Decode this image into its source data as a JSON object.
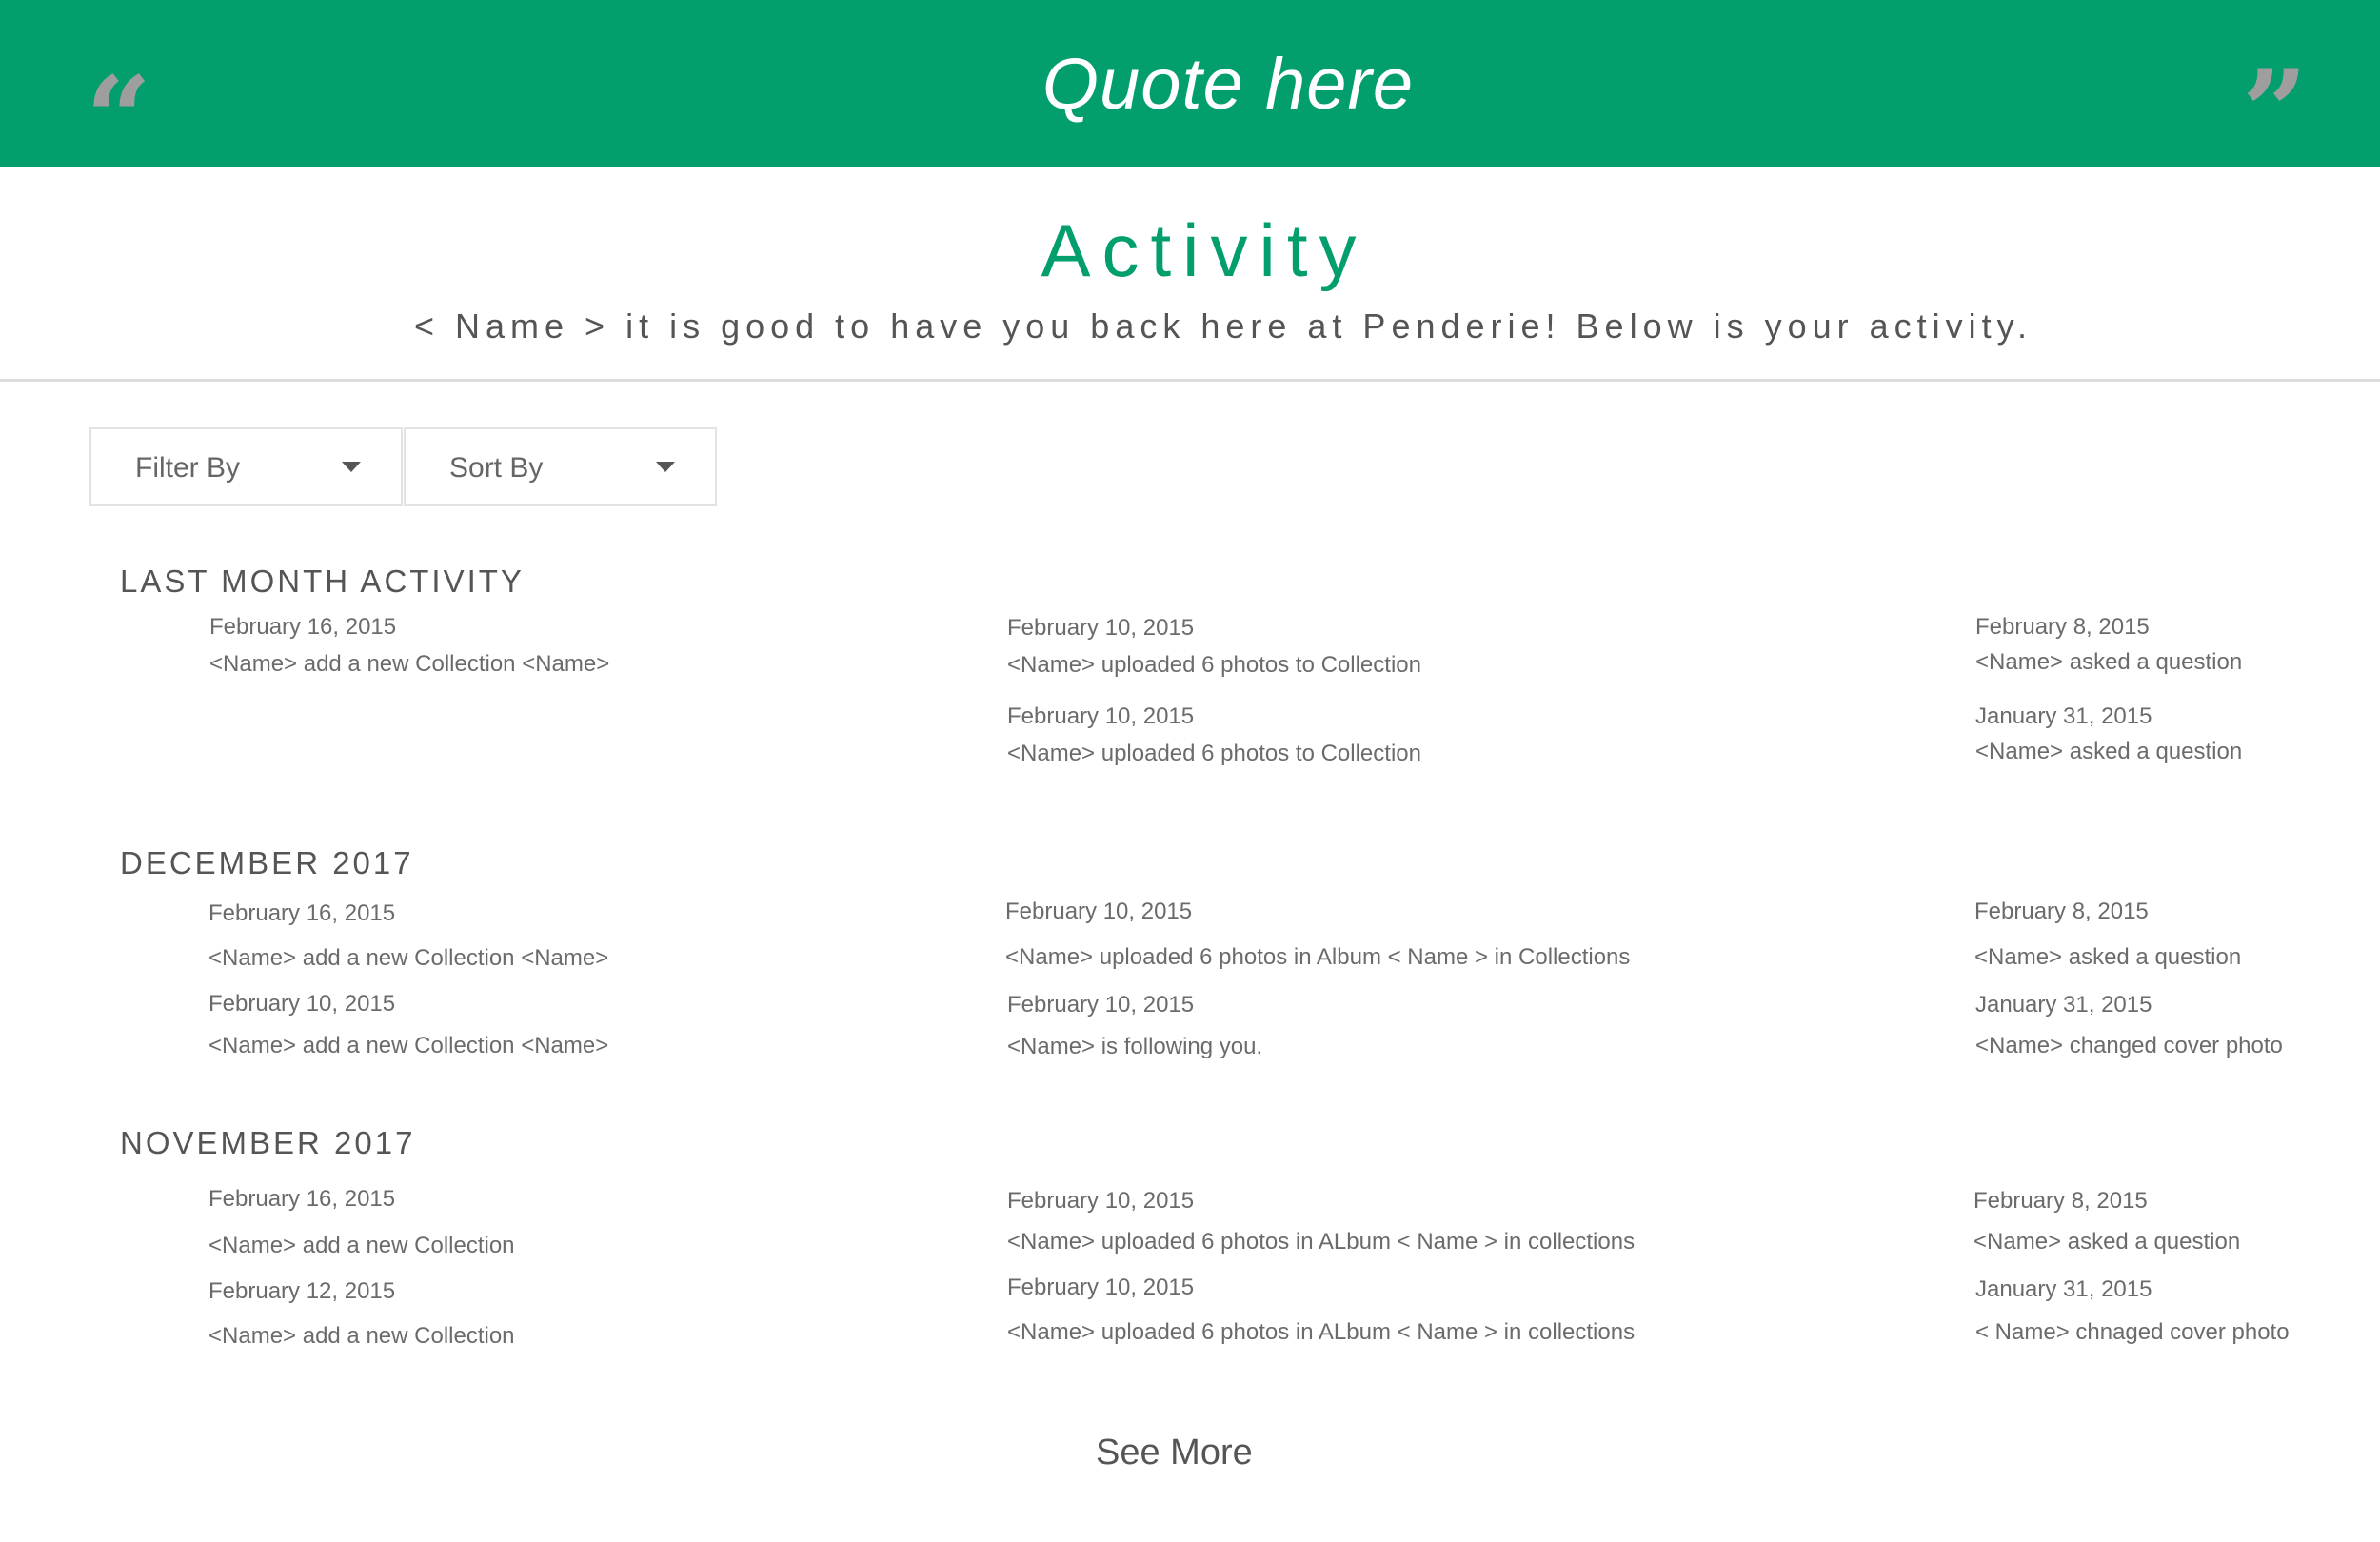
{
  "banner": {
    "quote": "Quote here",
    "open_quote_icon": "“",
    "close_quote_icon": "”",
    "background_color": "#039e6d",
    "icon_color": "#9e9e9e"
  },
  "header": {
    "title": "Activity",
    "subtitle": "< Name > it is good to have you back here at Penderie! Below is your activity.",
    "title_color": "#039e6d"
  },
  "filters": {
    "filter_label": "Filter By",
    "sort_label": "Sort By",
    "caret_icon": "caret-down-icon"
  },
  "sections": [
    {
      "title": "LAST MONTH ACTIVITY",
      "columns": [
        [
          {
            "date": "February 16, 2015",
            "desc": "<Name> add a new Collection <Name>"
          }
        ],
        [
          {
            "date": "February 10, 2015",
            "desc": "<Name> uploaded 6 photos to Collection"
          },
          {
            "date": "February 10, 2015",
            "desc": "<Name> uploaded 6 photos to Collection"
          }
        ],
        [
          {
            "date": "February 8, 2015",
            "desc": "<Name>  asked a question"
          },
          {
            "date": "January 31, 2015",
            "desc": "<Name>  asked a question"
          }
        ]
      ]
    },
    {
      "title": "DECEMBER 2017",
      "columns": [
        [
          {
            "date": "February 16, 2015",
            "desc": "<Name> add a new Collection <Name>"
          },
          {
            "date": "February 10, 2015",
            "desc": "<Name> add a new Collection <Name>"
          }
        ],
        [
          {
            "date": "February 10, 2015",
            "desc": "<Name> uploaded 6 photos in Album < Name > in Collections"
          },
          {
            "date": "February 10, 2015",
            "desc": "<Name> is following you."
          }
        ],
        [
          {
            "date": "February  8, 2015",
            "desc": "<Name> asked a question"
          },
          {
            "date": "January 31, 2015",
            "desc": "<Name> changed cover photo"
          }
        ]
      ]
    },
    {
      "title": "NOVEMBER 2017",
      "columns": [
        [
          {
            "date": "February 16, 2015",
            "desc": "<Name> add a new Collection"
          },
          {
            "date": "February 12, 2015",
            "desc": "<Name> add a new Collection"
          }
        ],
        [
          {
            "date": "February 10, 2015",
            "desc": "<Name> uploaded 6 photos in ALbum < Name > in collections"
          },
          {
            "date": "February 10, 2015",
            "desc": "<Name> uploaded 6 photos in ALbum < Name > in collections"
          }
        ],
        [
          {
            "date": "February 8, 2015",
            "desc": "<Name> asked a question"
          },
          {
            "date": "January 31, 2015",
            "desc": "< Name> chnaged cover photo"
          }
        ]
      ]
    }
  ],
  "footer": {
    "see_more": "See More"
  }
}
